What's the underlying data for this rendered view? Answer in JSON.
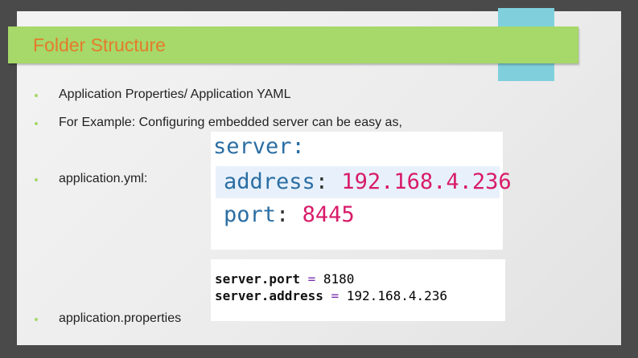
{
  "slide": {
    "title": "Folder Structure",
    "bullets": [
      "Application Properties/ Application YAML",
      "For Example: Configuring embedded server can be easy as,",
      "application.yml:",
      "application.properties"
    ],
    "yaml_code": {
      "server_key": "server",
      "address_key": "address",
      "address_value": "192.168.4.236",
      "port_key": "port",
      "port_value": "8445",
      "colon": ":"
    },
    "properties_code": {
      "line1_key": "server.port",
      "line1_value": "8180",
      "line2_key": "server.address",
      "line2_value": "192.168.4.236",
      "equals": "="
    }
  },
  "colors": {
    "title_band": "#a6d86a",
    "title_text": "#e57b2a",
    "accent_tab": "#7fd0dc",
    "yaml_key": "#2b6ea3",
    "yaml_value": "#d81b6a"
  }
}
